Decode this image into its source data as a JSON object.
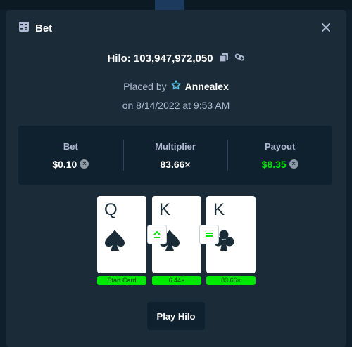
{
  "modal": {
    "title": "Bet",
    "game_line": "Hilo: 103,947,972,050",
    "placed_by_prefix": "Placed by",
    "username": "Annealex",
    "date": "on 8/14/2022 at 9:53 AM"
  },
  "stats": {
    "bet_label": "Bet",
    "bet_value": "$0.10",
    "multiplier_label": "Multiplier",
    "multiplier_value": "83.66×",
    "payout_label": "Payout",
    "payout_value": "$8.35"
  },
  "cards": [
    {
      "rank": "Q",
      "suit": "spade-icon",
      "tag": "Start Card"
    },
    {
      "rank": "K",
      "suit": "spade-icon",
      "tag": "6.44×"
    },
    {
      "rank": "K",
      "suit": "club-icon",
      "tag": "83.66×"
    }
  ],
  "guesses": [
    {
      "icon": "higher-or-same-icon"
    },
    {
      "icon": "same-icon"
    }
  ],
  "play_button": "Play Hilo",
  "colors": {
    "background": "#0f1f2b",
    "modal": "#1b2c38",
    "panel": "#0f212e",
    "accent_green": "#00e701",
    "muted_text": "#b1bad3"
  }
}
